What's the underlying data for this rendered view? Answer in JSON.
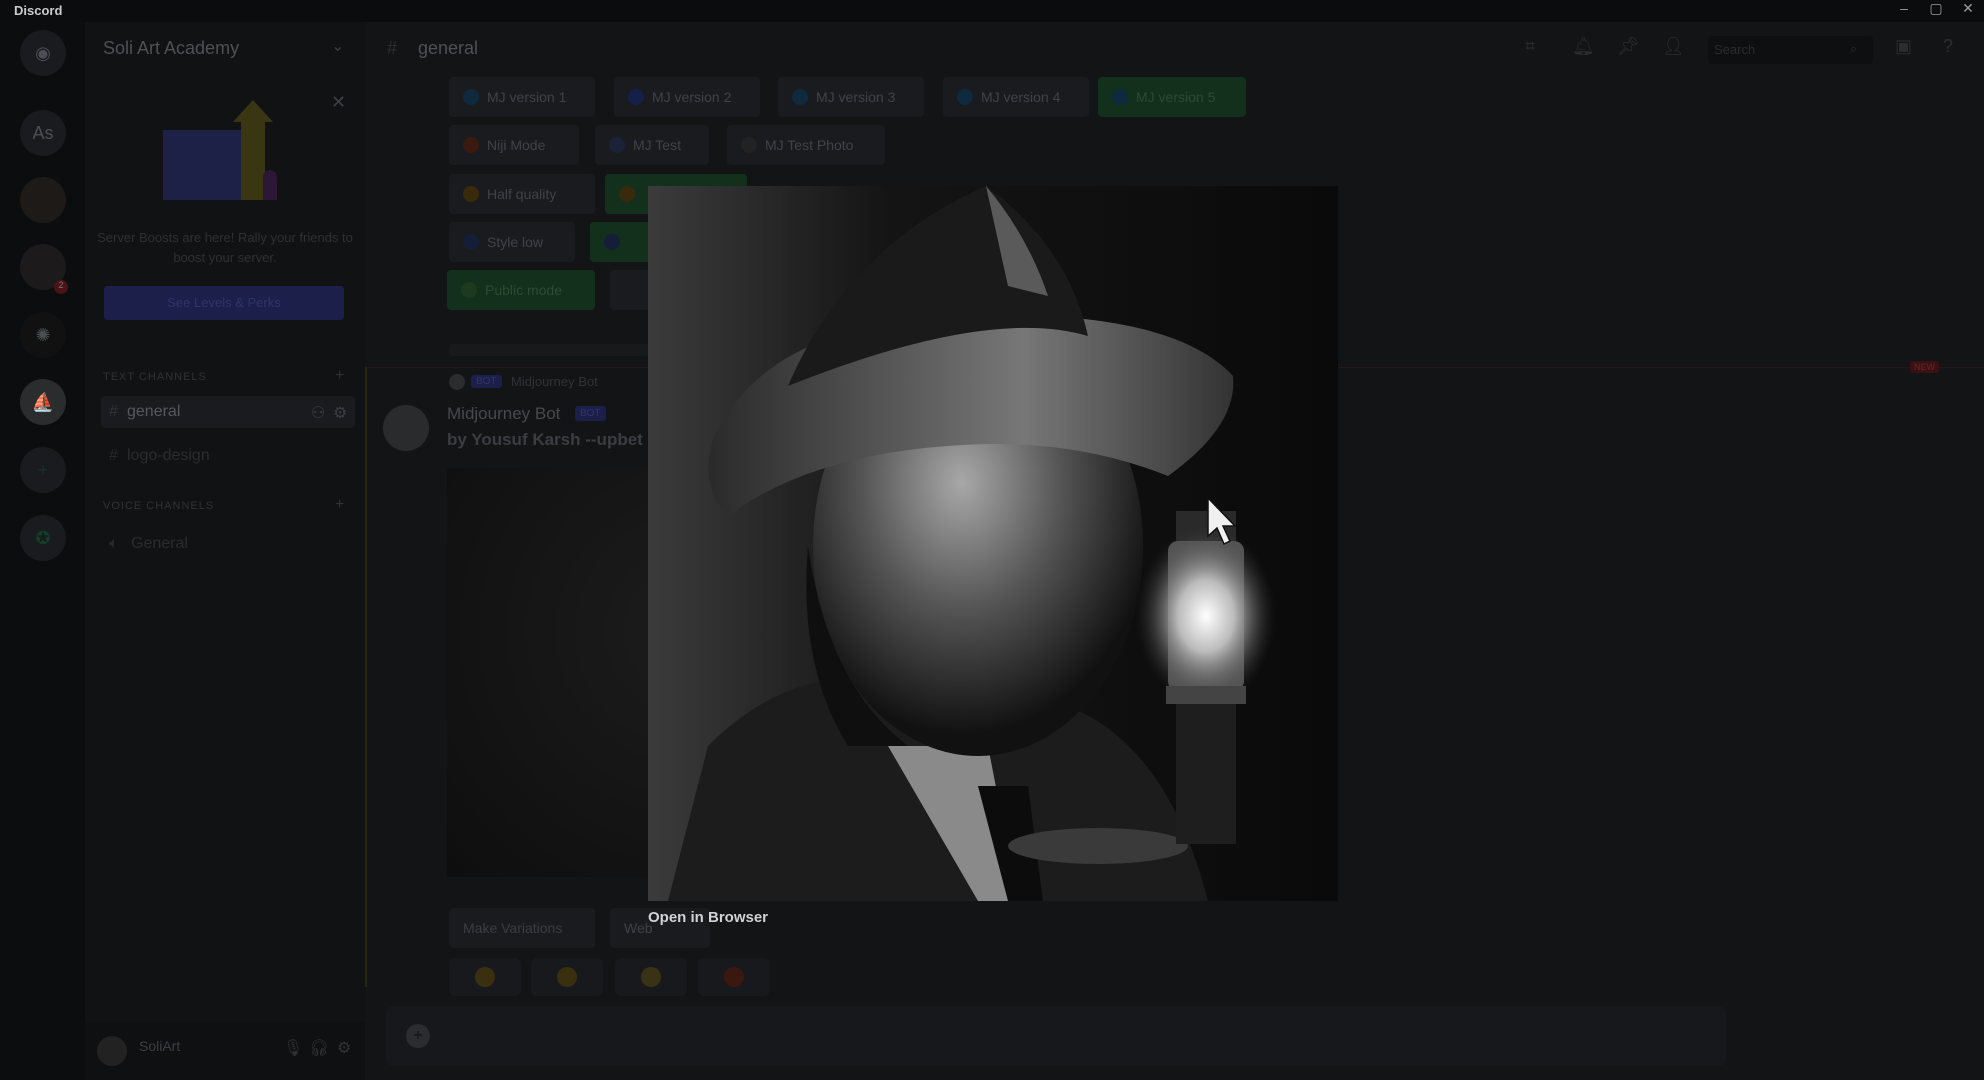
{
  "window": {
    "title": "Discord",
    "controls": [
      "minimize",
      "maximize",
      "close"
    ]
  },
  "server_rail": {
    "items": [
      {
        "icon": "discord-home-icon"
      },
      {
        "label": "As"
      },
      {
        "icon": "server-avatar"
      },
      {
        "icon": "server-avatar",
        "badge": "2"
      },
      {
        "icon": "openai-icon"
      },
      {
        "icon": "midjourney-icon"
      },
      {
        "icon": "add-server-icon",
        "label": "+"
      },
      {
        "icon": "explore-icon"
      }
    ]
  },
  "sidebar": {
    "server_name": "Soli Art Academy",
    "boost_card": {
      "text": "Server Boosts are here! Rally your friends to boost your server.",
      "button": "See Levels & Perks"
    },
    "text_category": "TEXT CHANNELS",
    "text_channels": [
      {
        "name": "general",
        "active": true
      },
      {
        "name": "logo-design"
      }
    ],
    "voice_category": "VOICE CHANNELS",
    "voice_channels": [
      {
        "name": "General"
      }
    ],
    "user": {
      "name": "SoliArt"
    }
  },
  "header": {
    "channel": "general",
    "search_placeholder": "Search"
  },
  "settings_buttons": {
    "row1": [
      {
        "label": "MJ version 1",
        "icon": "1"
      },
      {
        "label": "MJ version 2",
        "icon": "2"
      },
      {
        "label": "MJ version 3",
        "icon": "3"
      },
      {
        "label": "MJ version 4",
        "icon": "4"
      },
      {
        "label": "MJ version 5",
        "icon": "5",
        "active": true
      }
    ],
    "row2": [
      {
        "label": "Niji Mode"
      },
      {
        "label": "MJ Test"
      },
      {
        "label": "MJ Test Photo"
      }
    ],
    "row3": [
      {
        "label": "Half quality"
      }
    ],
    "row4": [
      {
        "label": "Style low"
      }
    ],
    "row5": [
      {
        "label": "Public mode",
        "active": true
      }
    ]
  },
  "divider_badge": "NEW",
  "message": {
    "reply_tag": "BOT",
    "reply_author": "Midjourney Bot",
    "author": "Midjourney Bot",
    "bot_tag": "BOT",
    "text": "by Yousuf Karsh --upbet",
    "buttons": [
      "Make Variations",
      "Web"
    ],
    "reactions": [
      "emoji-1",
      "emoji-2",
      "emoji-3",
      "emoji-4"
    ]
  },
  "lightbox": {
    "open_in_browser": "Open in Browser"
  },
  "colors": {
    "accent": "#5865f2",
    "green": "#248046",
    "new_badge": "#f23f43"
  }
}
